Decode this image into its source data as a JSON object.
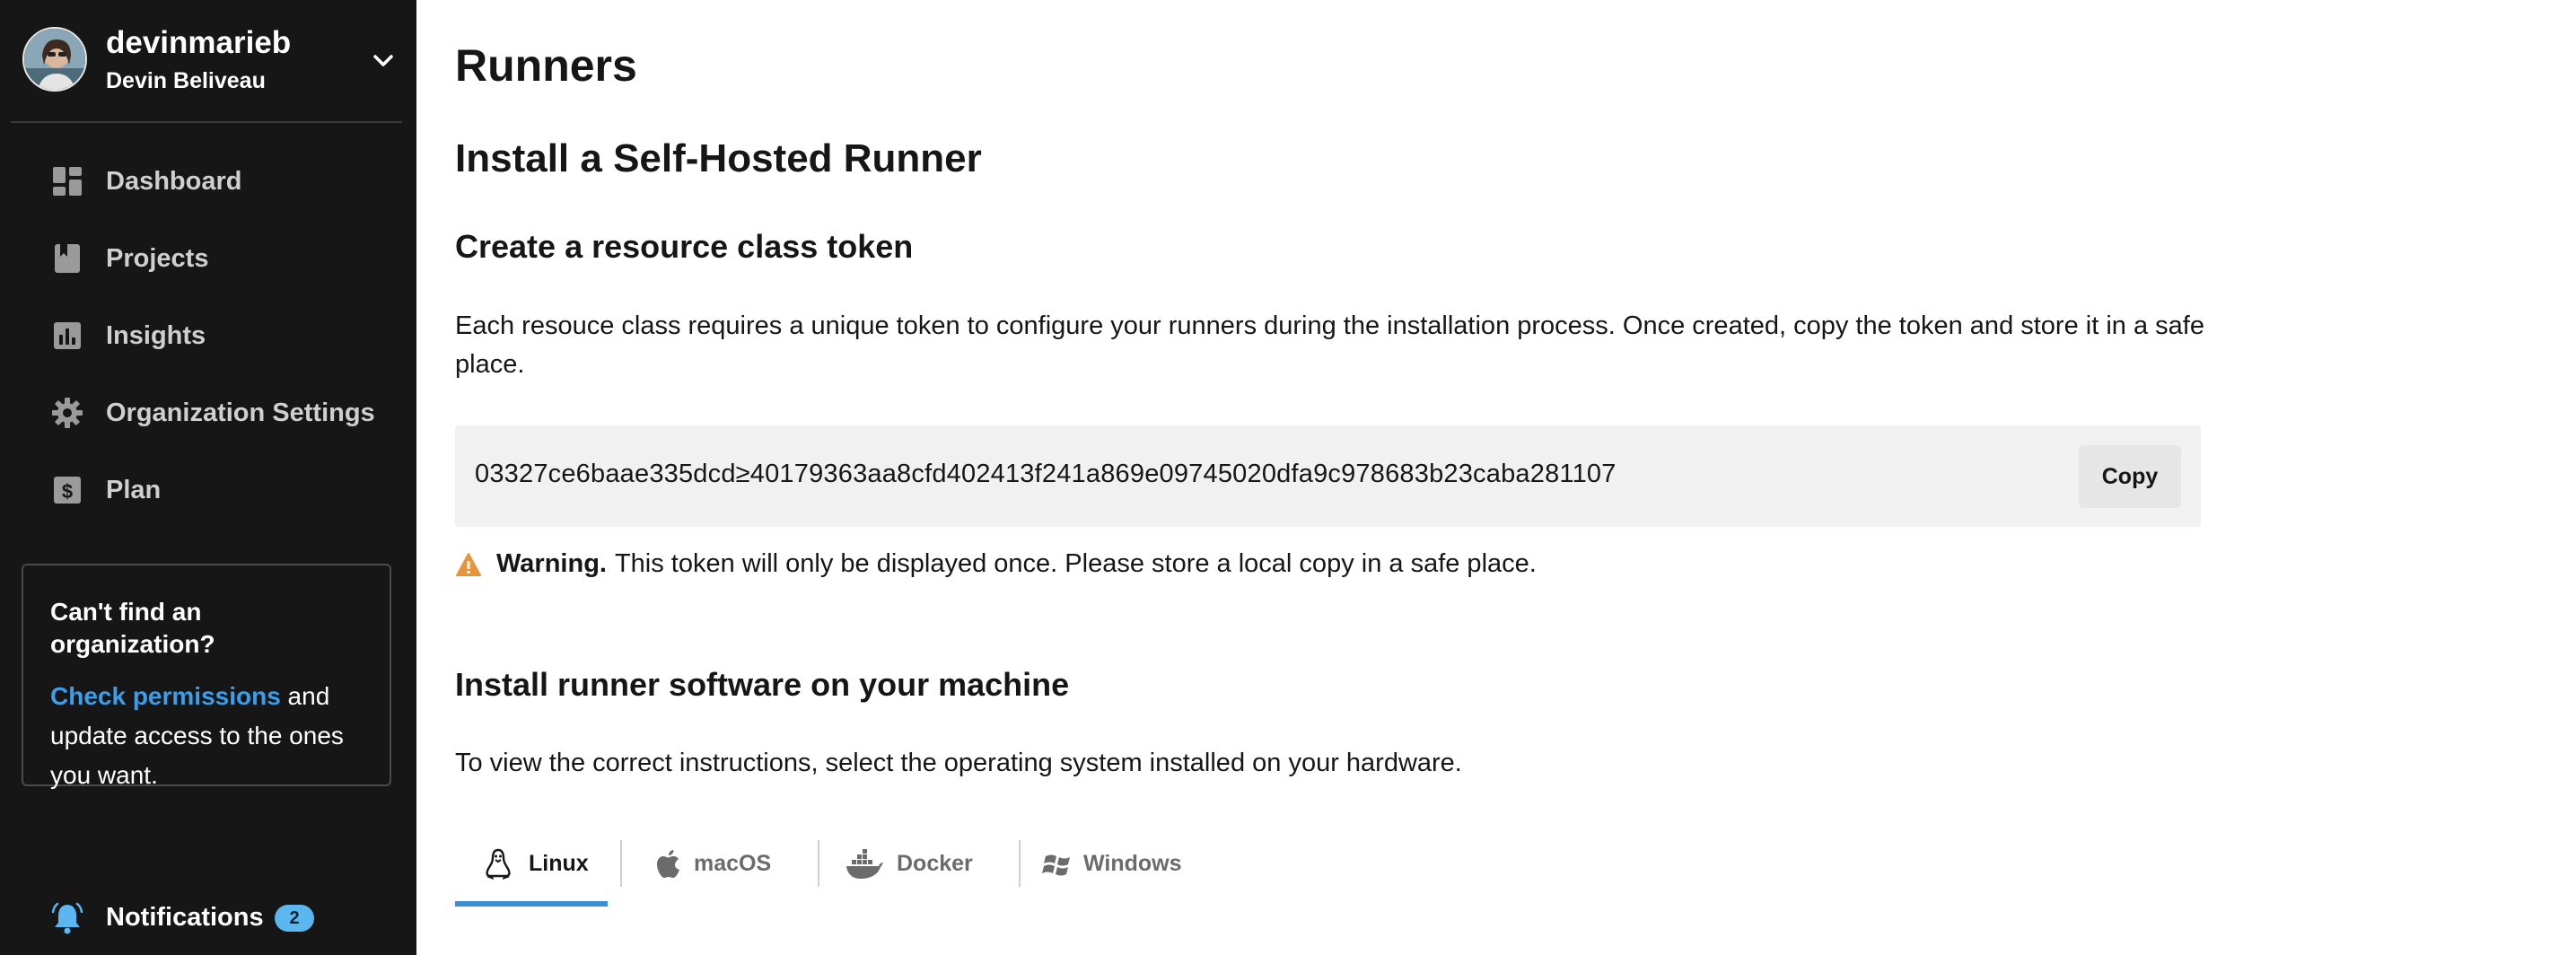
{
  "org": {
    "name": "devinmarieb",
    "user": "Devin Beliveau"
  },
  "nav": {
    "items": [
      {
        "label": "Dashboard",
        "icon": "dashboard-icon"
      },
      {
        "label": "Projects",
        "icon": "projects-icon"
      },
      {
        "label": "Insights",
        "icon": "insights-icon"
      },
      {
        "label": "Organization Settings",
        "icon": "gear-icon"
      },
      {
        "label": "Plan",
        "icon": "plan-icon"
      }
    ]
  },
  "help": {
    "title": "Can't find an organization?",
    "link": "Check permissions",
    "text": " and update access to the ones you want."
  },
  "notifications": {
    "label": "Notifications",
    "count": "2"
  },
  "main": {
    "page_title": "Runners",
    "section_title": "Install a Self-Hosted Runner",
    "token_title": "Create a resource class token",
    "token_desc": "Each resouce class requires a unique token to configure your runners during the installation process. Once created, copy the token and store it in a safe place.",
    "token_value": "03327ce6baae335dcd≥40179363aa8cfd402413f241a869e09745020dfa9c978683b23caba281107",
    "copy_label": "Copy",
    "warning_strong": "Warning.",
    "warning_text": "This token will only be displayed once. Please store a local copy in a safe place.",
    "install_title": "Install runner software on your machine",
    "install_desc": "To view the correct instructions, select the operating system installed on your hardware.",
    "tabs": [
      {
        "label": "Linux",
        "icon": "linux-icon",
        "active": true
      },
      {
        "label": "macOS",
        "icon": "apple-icon",
        "active": false
      },
      {
        "label": "Docker",
        "icon": "docker-icon",
        "active": false
      },
      {
        "label": "Windows",
        "icon": "windows-icon",
        "active": false
      }
    ]
  },
  "colors": {
    "sidebar_bg": "#161616",
    "accent_blue": "#3b8fd8",
    "link_blue": "#3b9eea",
    "badge_blue": "#5ab7ef",
    "warning_orange": "#e8943a"
  }
}
